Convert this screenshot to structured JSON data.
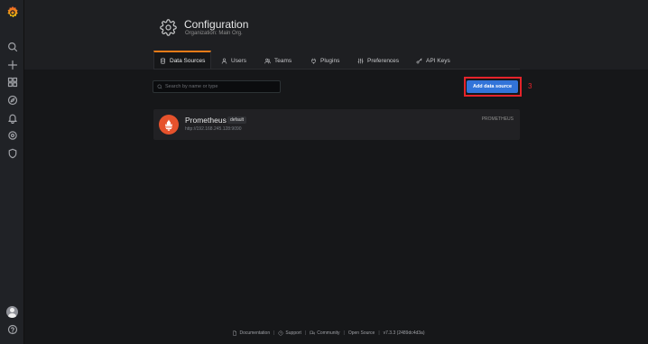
{
  "page": {
    "title": "Configuration",
    "subtitle": "Organization: Main Org."
  },
  "tabs": [
    {
      "label": "Data Sources",
      "icon": "database-icon",
      "active": true
    },
    {
      "label": "Users",
      "icon": "user-icon"
    },
    {
      "label": "Teams",
      "icon": "users-icon"
    },
    {
      "label": "Plugins",
      "icon": "plug-icon"
    },
    {
      "label": "Preferences",
      "icon": "sliders-icon"
    },
    {
      "label": "API Keys",
      "icon": "key-icon"
    }
  ],
  "search": {
    "placeholder": "Search by name or type",
    "value": ""
  },
  "actions": {
    "add_data_source": "Add data source"
  },
  "annotation": {
    "step_number": "3"
  },
  "datasources": [
    {
      "name": "Prometheus",
      "badge": "default",
      "url": "http://192.168.245.128:9090",
      "type": "PROMETHEUS",
      "icon": "prometheus-icon"
    }
  ],
  "footer": {
    "documentation": "Documentation",
    "support": "Support",
    "community": "Community",
    "open_source": "Open Source",
    "version": "v7.3.3 (2489dc4d3a)",
    "separator": "|"
  },
  "colors": {
    "accent": "#eb7b18",
    "primary_button": "#3274d9",
    "annotation": "#e5232a",
    "prometheus": "#e6522c"
  }
}
